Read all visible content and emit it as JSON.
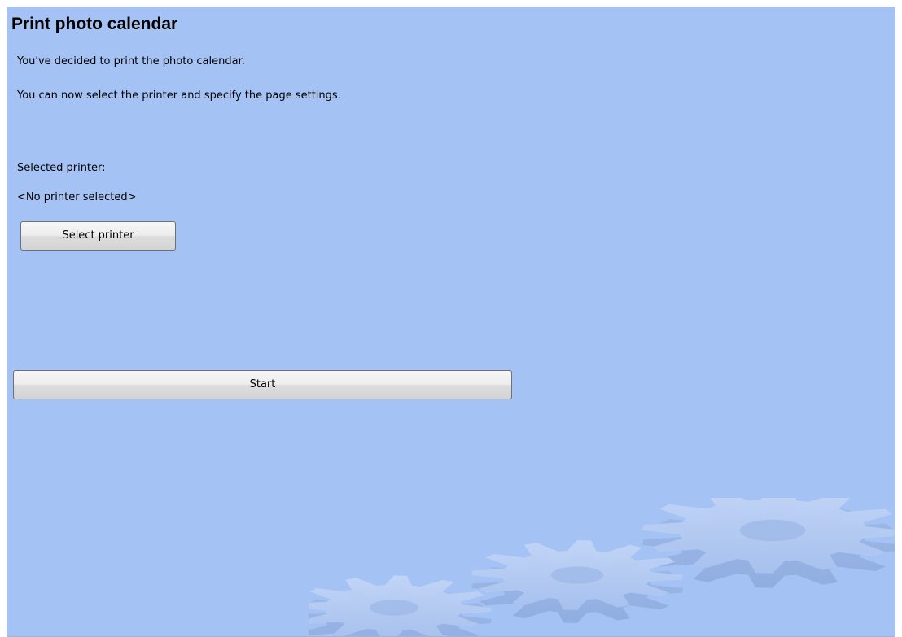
{
  "title": "Print photo calendar",
  "intro": {
    "line1": "You've decided to print the photo calendar.",
    "line2": "You can now select the printer and specify the page settings."
  },
  "printer": {
    "label": "Selected printer:",
    "value": "<No printer selected>",
    "select_button": "Select printer"
  },
  "start_button": "Start",
  "colors": {
    "background": "#a4c2f4",
    "gear": "#b8cdf3"
  },
  "decoration": {
    "icon": "gears-icon"
  }
}
